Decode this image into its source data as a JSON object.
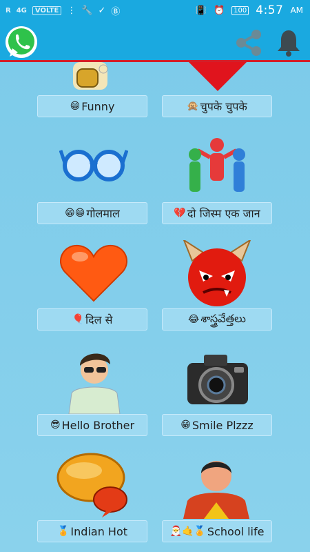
{
  "status_bar": {
    "signal_label": "R",
    "network": "4G",
    "volte": "VOLTE",
    "battery": "100",
    "time": "4:57",
    "ampm": "AM"
  },
  "app_bar": {
    "logo": "whatsapp-logo",
    "share_icon": "share-icon",
    "bell_icon": "bell-icon",
    "accent": "#d21f2a"
  },
  "tiles": [
    {
      "label": "Funny",
      "emoji": "😁"
    },
    {
      "label": "चुपके चुपके",
      "emoji": "🙊"
    },
    {
      "label": "गोलमाल",
      "emoji": "😁😁"
    },
    {
      "label": "दो जिस्म एक जान",
      "emoji": "💔"
    },
    {
      "label": "दिल से",
      "emoji": "🎈"
    },
    {
      "label": "శాస్త్రవేత్తలు",
      "emoji": "😂"
    },
    {
      "label": "Hello Brother",
      "emoji": "😎"
    },
    {
      "label": "Smile Plzzz",
      "emoji": "😁"
    },
    {
      "label": "Indian Hot",
      "emoji": "🏅"
    },
    {
      "label": "School life",
      "emoji": "🎅🤙🏅"
    }
  ]
}
